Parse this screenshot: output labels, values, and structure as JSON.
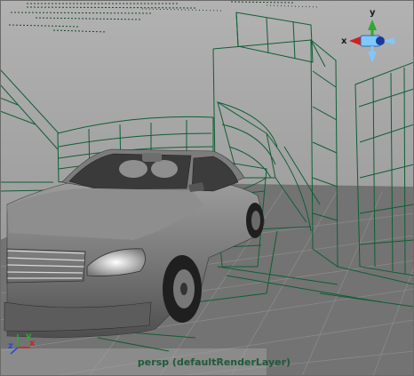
{
  "viewport": {
    "camera_label": "persp (defaultRenderLayer)"
  },
  "view_cube": {
    "axis_x": "x",
    "axis_y": "y"
  },
  "origin_axes": {
    "axis_x": "x",
    "axis_y": "y",
    "axis_z": "z"
  },
  "colors": {
    "wireframe": "#0f5e33",
    "ground": "#6e6e6e",
    "upper_bg": "#a3a3a3",
    "label": "#1e5a3a"
  }
}
